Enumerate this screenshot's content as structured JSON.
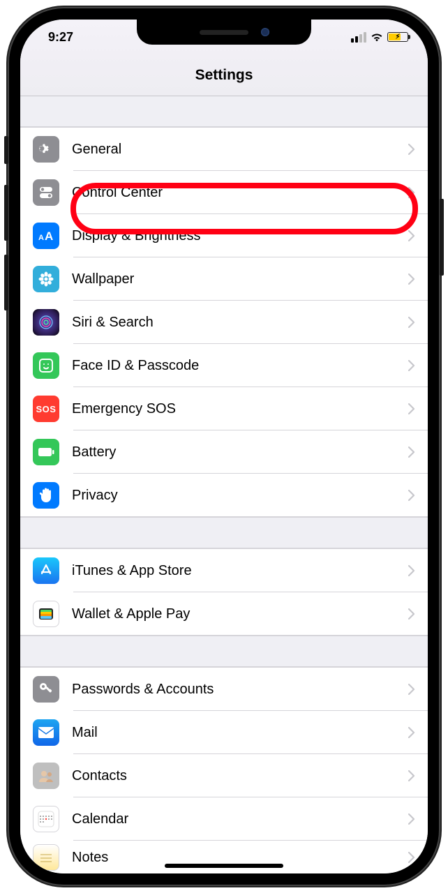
{
  "statusbar": {
    "time": "9:27"
  },
  "navbar": {
    "title": "Settings"
  },
  "groups": [
    {
      "items": [
        {
          "label": "General",
          "icon": "gear-icon",
          "bg": "bg-gray"
        },
        {
          "label": "Control Center",
          "icon": "toggles-icon",
          "bg": "bg-gray"
        },
        {
          "label": "Display & Brightness",
          "icon": "text-size-icon",
          "bg": "bg-blue",
          "highlighted": true
        },
        {
          "label": "Wallpaper",
          "icon": "flower-icon",
          "bg": "bg-cyan"
        },
        {
          "label": "Siri & Search",
          "icon": "siri-icon",
          "bg": "bg-siri"
        },
        {
          "label": "Face ID & Passcode",
          "icon": "faceid-icon",
          "bg": "bg-green"
        },
        {
          "label": "Emergency SOS",
          "icon": "sos-icon",
          "bg": "bg-red"
        },
        {
          "label": "Battery",
          "icon": "battery-icon",
          "bg": "bg-green"
        },
        {
          "label": "Privacy",
          "icon": "hand-icon",
          "bg": "bg-blue"
        }
      ]
    },
    {
      "items": [
        {
          "label": "iTunes & App Store",
          "icon": "appstore-icon",
          "bg": "bg-blue-appstore"
        },
        {
          "label": "Wallet & Apple Pay",
          "icon": "wallet-icon",
          "bg": "bg-white"
        }
      ]
    },
    {
      "items": [
        {
          "label": "Passwords & Accounts",
          "icon": "key-icon",
          "bg": "bg-gray"
        },
        {
          "label": "Mail",
          "icon": "mail-icon",
          "bg": "bg-blue-mail"
        },
        {
          "label": "Contacts",
          "icon": "contacts-icon",
          "bg": "bg-gray-contacts"
        },
        {
          "label": "Calendar",
          "icon": "calendar-icon",
          "bg": "bg-white"
        },
        {
          "label": "Notes",
          "icon": "notes-icon",
          "bg": "bg-white"
        }
      ]
    }
  ]
}
